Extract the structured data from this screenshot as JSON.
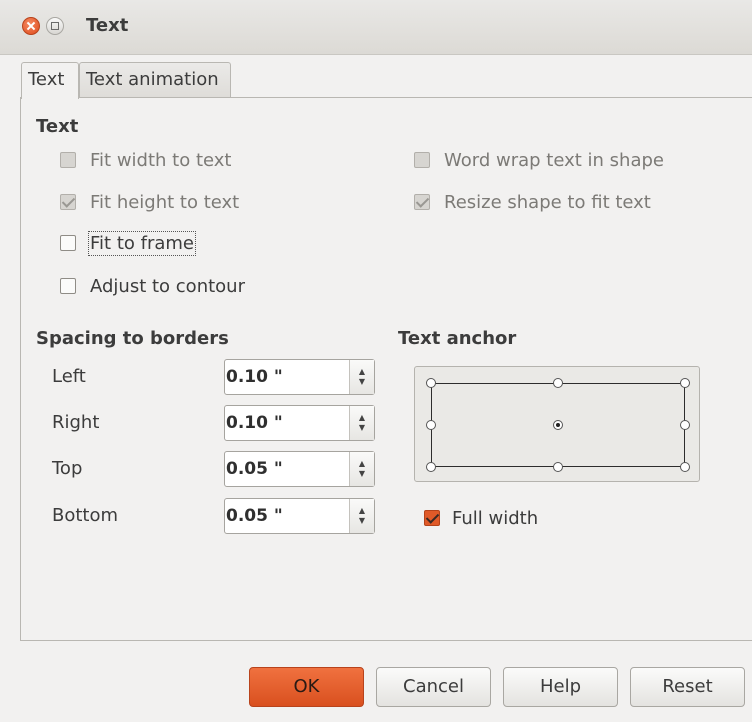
{
  "window": {
    "title": "Text"
  },
  "tabs": [
    {
      "label": "Text",
      "active": true
    },
    {
      "label": "Text animation",
      "active": false
    }
  ],
  "text_section": {
    "title": "Text",
    "options": [
      {
        "label": "Fit width to text",
        "checked": false,
        "enabled": false
      },
      {
        "label": "Fit height to text",
        "checked": true,
        "enabled": false
      },
      {
        "label": "Fit to frame",
        "checked": false,
        "enabled": true,
        "focused": true
      },
      {
        "label": "Adjust to contour",
        "checked": false,
        "enabled": true
      },
      {
        "label": "Word wrap text in shape",
        "checked": false,
        "enabled": false
      },
      {
        "label": "Resize shape to fit text",
        "checked": true,
        "enabled": false
      }
    ]
  },
  "spacing": {
    "title": "Spacing to borders",
    "rows": [
      {
        "label": "Left",
        "value": "0.10 \""
      },
      {
        "label": "Right",
        "value": "0.10 \""
      },
      {
        "label": "Top",
        "value": "0.05 \""
      },
      {
        "label": "Bottom",
        "value": "0.05 \""
      }
    ]
  },
  "anchor": {
    "title": "Text anchor",
    "selected": "center",
    "full_width_label": "Full width",
    "full_width_checked": true
  },
  "buttons": {
    "ok": "OK",
    "cancel": "Cancel",
    "help": "Help",
    "reset": "Reset"
  },
  "colors": {
    "accent": "#df5420",
    "window_bg": "#f2f1f0"
  }
}
